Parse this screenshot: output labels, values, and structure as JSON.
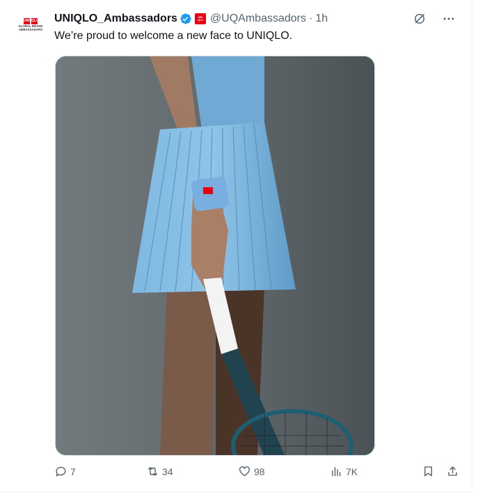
{
  "tweet": {
    "author_name": "UNIQLO_Ambassadors",
    "handle": "@UQAmbassadors",
    "separator": "·",
    "time": "1h",
    "text": "We’re proud to welcome a new face to UNIQLO.",
    "avatar": {
      "brand_top": "UNI",
      "brand_bottom": "QLO",
      "line1": "GLOBAL BRAND",
      "line2": "AMBASSADORS"
    },
    "mini_logo": {
      "top": "UNI",
      "bottom": "QLO"
    },
    "icons": {
      "verified": "verified-badge-icon",
      "grok": "grok-icon",
      "more": "more-icon",
      "reply": "reply-icon",
      "retweet": "retweet-icon",
      "like": "like-icon",
      "views": "views-icon",
      "bookmark": "bookmark-icon",
      "share": "share-icon"
    },
    "colors": {
      "verified": "#1d9bf0",
      "brand_red": "#e60012",
      "muted": "#536471"
    }
  },
  "metrics": {
    "replies": "7",
    "retweets": "34",
    "likes": "98",
    "views": "7K"
  }
}
